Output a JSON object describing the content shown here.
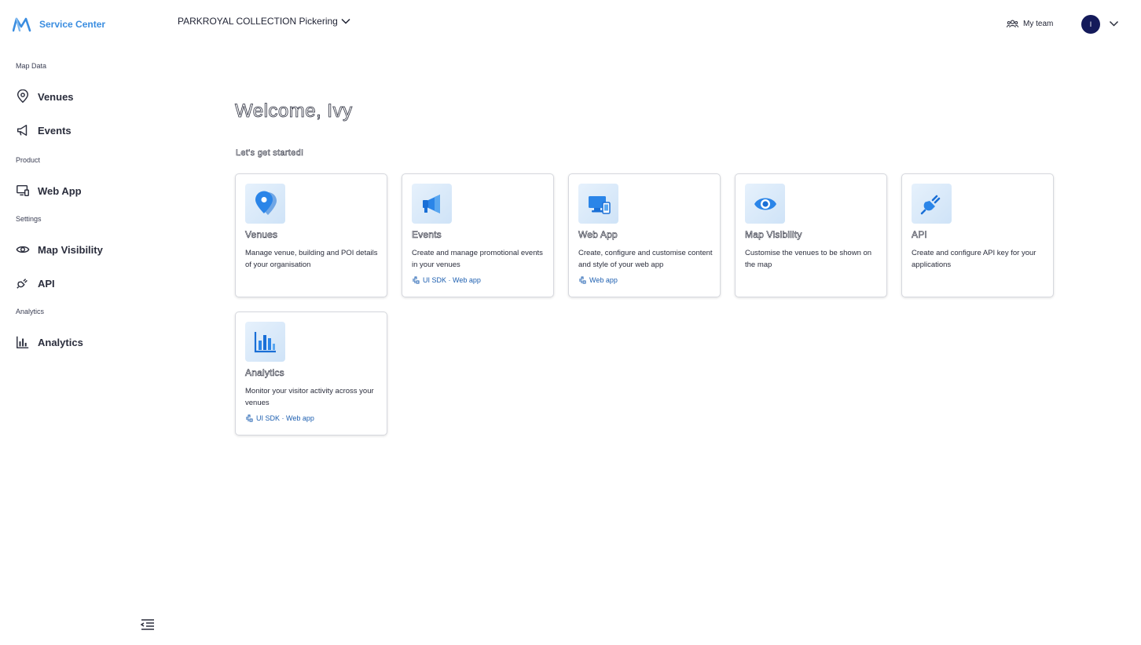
{
  "brand": {
    "name": "Service Center"
  },
  "header": {
    "venue": "PARKROYAL COLLECTION Pickering",
    "team_label": "My team",
    "avatar_initial": "I"
  },
  "sidebar": {
    "sections": [
      {
        "title": "Map Data"
      },
      {
        "title": "Product"
      },
      {
        "title": "Settings"
      },
      {
        "title": "Analytics"
      }
    ],
    "items": [
      {
        "label": "Venues",
        "icon": "map-pin-icon"
      },
      {
        "label": "Events",
        "icon": "megaphone-icon"
      },
      {
        "label": "Web App",
        "icon": "devices-icon"
      },
      {
        "label": "Map Visibility",
        "icon": "eye-icon"
      },
      {
        "label": "API",
        "icon": "plug-icon"
      },
      {
        "label": "Analytics",
        "icon": "bar-chart-icon"
      }
    ]
  },
  "main": {
    "welcome": "Welcome, Ivy",
    "subtitle": "Let's get started!",
    "cards": [
      {
        "title": "Venues",
        "desc": "Manage venue, building and POI details of your organisation",
        "tags": ""
      },
      {
        "title": "Events",
        "desc": "Create and manage promotional events in your venues",
        "tags": "UI SDK · Web app"
      },
      {
        "title": "Web App",
        "desc": "Create, configure and customise content and style of your web app",
        "tags": "Web app"
      },
      {
        "title": "Map Visibility",
        "desc": "Customise the venues to be shown on the map",
        "tags": ""
      },
      {
        "title": "API",
        "desc": "Create and configure API key for your applications",
        "tags": ""
      },
      {
        "title": "Analytics",
        "desc": "Monitor your visitor activity across your venues",
        "tags": "UI SDK · Web app"
      }
    ]
  },
  "colors": {
    "accent": "#3a8de0",
    "link": "#1d5fb0",
    "avatar": "#141a5a"
  }
}
